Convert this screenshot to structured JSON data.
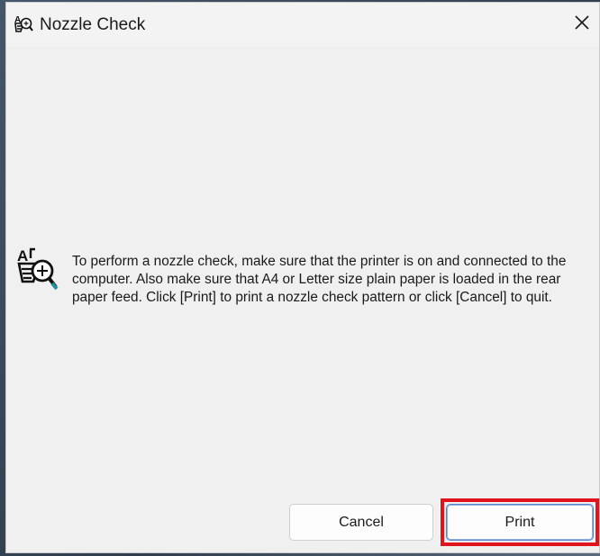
{
  "window": {
    "title": "Nozzle Check",
    "title_icon": "printer-alignment-icon",
    "close_icon": "close-icon"
  },
  "content": {
    "icon": "nozzle-check-magnifier-icon",
    "message": "To perform a nozzle check, make sure that the printer is on and connected to the computer. Also make sure that A4 or Letter size plain paper is loaded in the rear paper feed. Click [Print] to print a nozzle check pattern or click [Cancel] to quit."
  },
  "buttons": {
    "cancel_label": "Cancel",
    "print_label": "Print"
  },
  "colors": {
    "dialog_background": "#f0f0f0",
    "highlight": "#e2141b",
    "focus_border": "#5a84c9"
  }
}
